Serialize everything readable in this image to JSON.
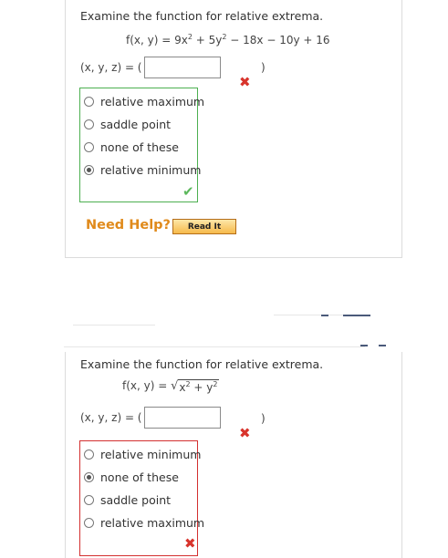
{
  "problem1": {
    "prompt": "Examine the function for relative extrema.",
    "function_label": "f(x, y) = 9x",
    "function_mid1": " + 5y",
    "function_end": " − 18x − 10y + 16",
    "sup": "2",
    "answer_label": "(x, y, z) = (",
    "answer_value": "",
    "close_paren": ")",
    "answer_status": "incorrect",
    "options": [
      "relative maximum",
      "saddle point",
      "none of these",
      "relative minimum"
    ],
    "selected": "relative minimum",
    "choice_status": "correct",
    "need_help": "Need Help?",
    "read_it": "Read It"
  },
  "problem2": {
    "prompt": "Examine the function for relative extrema.",
    "function_label": "f(x, y) = ",
    "sqrt_x": "x",
    "sqrt_plus": " + y",
    "sup": "2",
    "answer_label": "(x, y, z) = (",
    "answer_value": "",
    "close_paren": ")",
    "answer_status": "incorrect",
    "options": [
      "relative minimum",
      "none of these",
      "saddle point",
      "relative maximum"
    ],
    "selected": "none of these",
    "choice_status": "incorrect"
  },
  "colors": {
    "correct": "#4caf50",
    "incorrect": "#d32f2f",
    "help": "#e08a1b"
  },
  "icons": {
    "incorrect": "x-mark-icon",
    "correct": "check-mark-icon"
  }
}
